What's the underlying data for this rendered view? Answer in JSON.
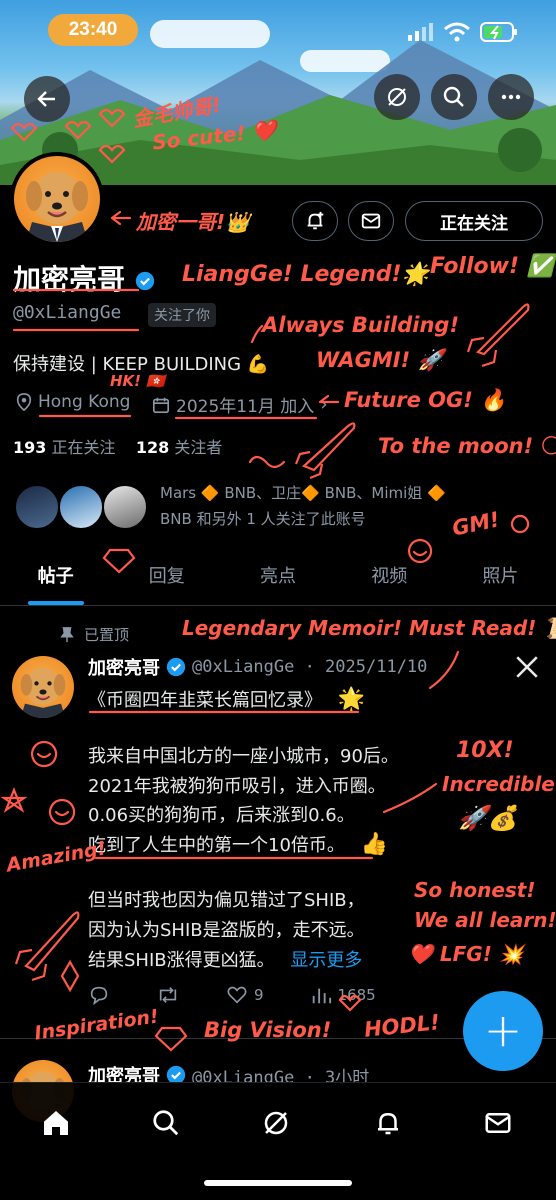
{
  "status_bar": {
    "time": "23:40"
  },
  "profile": {
    "display_name": "加密亮哥",
    "handle": "@0xLiangGe",
    "follows_you": "关注了你",
    "bio": "保持建设 | KEEP BUILDING 💪",
    "location": "Hong Kong",
    "joined": "2025年11月 加入",
    "following_count": "193",
    "following_label": "正在关注",
    "followers_count": "128",
    "followers_label": "关注者",
    "follow_button": "正在关注",
    "followed_by_line1": "Mars 🔶 BNB、卫庄🔶 BNB、Mimi姐 🔶",
    "followed_by_line2": "BNB 和另外 1 人关注了此账号"
  },
  "tabs": [
    {
      "label": "帖子"
    },
    {
      "label": "回复"
    },
    {
      "label": "亮点"
    },
    {
      "label": "视频"
    },
    {
      "label": "照片"
    }
  ],
  "pinned_post": {
    "pinned_label": "已置顶",
    "author": "加密亮哥",
    "handle_date": "@0xLiangGe · 2025/11/10",
    "title": "《币圈四年韭菜长篇回忆录》",
    "title_emoji": "🌟",
    "lines": [
      "我来自中国北方的一座小城市，90后。",
      "2021年我被狗狗币吸引，进入币圈。",
      "0.06买的狗狗币，后来涨到0.6。",
      "吃到了人生中的第一个10倍币。",
      "但当时我也因为偏见错过了SHIB，",
      "因为认为SHIB是盗版的，走不远。",
      "结果SHIB涨得更凶猛。"
    ],
    "thumbs": "👍",
    "show_more": "显示更多",
    "stats": {
      "likes": "9",
      "views": "1685"
    }
  },
  "second_post": {
    "author": "加密亮哥",
    "handle_time": "@0xLiangGe · 3小时"
  },
  "annotations": {
    "a1": "金毛帅哥!",
    "a2": "So cute! ❤️",
    "a3": "加密一哥!👑",
    "a4": "LiangGe! Legend!🌟",
    "a5": "Follow! ✅",
    "a6": "Always Building!",
    "a7": "WAGMI! 🚀",
    "a8": "HK! 🇭🇰",
    "a9": "Future OG! 🔥",
    "a10": "To the moon! 🌕",
    "a11": "GM!",
    "a12": "Legendary Memoir! Must Read! 📜",
    "a13": "10X!",
    "a14": "Incredible!",
    "a15": "🚀💰",
    "a16": "Amazing!",
    "a17": "So honest!",
    "a18": "We all learn!",
    "a19": "❤️ LFG! 💥",
    "a20": "Inspiration!",
    "a21": "Big Vision!",
    "a22": "HODL!"
  },
  "colors": {
    "accent": "#1d9bf0",
    "annotation": "#ff5a4a",
    "time_pill": "#f2a93b"
  }
}
